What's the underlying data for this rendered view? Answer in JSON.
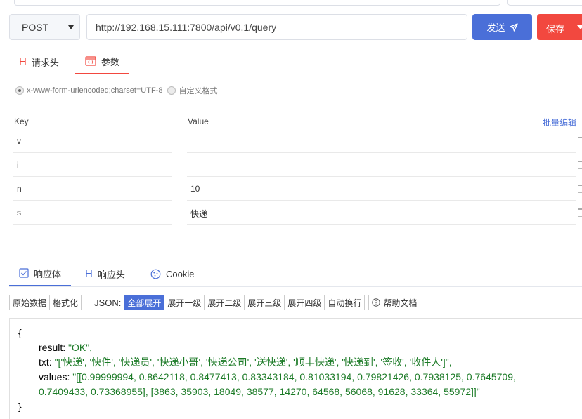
{
  "request": {
    "method": "POST",
    "url": "http://192.168.15.111:7800/api/v0.1/query",
    "send_label": "发送",
    "save_label": "保存"
  },
  "request_tabs": [
    {
      "label": "请求头",
      "icon": "heading-icon"
    },
    {
      "label": "参数",
      "icon": "code-icon",
      "active": true
    }
  ],
  "body_type": {
    "option1": "x-www-form-urlencoded;charset=UTF-8",
    "option2": "自定义格式",
    "selected": "x-www-form-urlencoded;charset=UTF-8"
  },
  "params": {
    "key_header": "Key",
    "value_header": "Value",
    "bulk_edit": "批量编辑",
    "rows": [
      {
        "key": "v",
        "value": ""
      },
      {
        "key": "i",
        "value": ""
      },
      {
        "key": "n",
        "value": "10"
      },
      {
        "key": "s",
        "value": "快递"
      },
      {
        "key": "",
        "value": ""
      }
    ]
  },
  "response_tabs": [
    {
      "label": "响应体",
      "icon": "checkbox-icon",
      "active": true
    },
    {
      "label": "响应头",
      "icon": "heading-icon"
    },
    {
      "label": "Cookie",
      "icon": "cookie-icon"
    }
  ],
  "toolbar": {
    "raw": "原始数据",
    "format": "格式化",
    "json_label": "JSON:",
    "expand_all": "全部展开",
    "expand_1": "展开一级",
    "expand_2": "展开二级",
    "expand_3": "展开三级",
    "expand_4": "展开四级",
    "auto_wrap": "自动换行",
    "help": "帮助文档"
  },
  "response": {
    "open": "{",
    "close": "}",
    "result_key": "result",
    "result_val": "\"OK\",",
    "txt_key": "txt",
    "txt_val": "\"['快递', '快件', '快递员', '快递小哥', '快递公司', '送快递', '顺丰快递', '快递到', '签收', '收件人']\",",
    "values_key": "values",
    "values_val_1": "\"[[0.99999994, 0.8642118, 0.8477413, 0.83343184, 0.81033194, 0.79821426, 0.7938125, 0.7645709,",
    "values_val_2": "0.7409433, 0.73368955], [3863, 35903, 18049, 38577, 14270, 64568, 56068, 91628, 33364, 55972]]\""
  },
  "colors": {
    "send": "#4a6fd8",
    "save": "#f2483f",
    "string": "#1b7a26"
  }
}
